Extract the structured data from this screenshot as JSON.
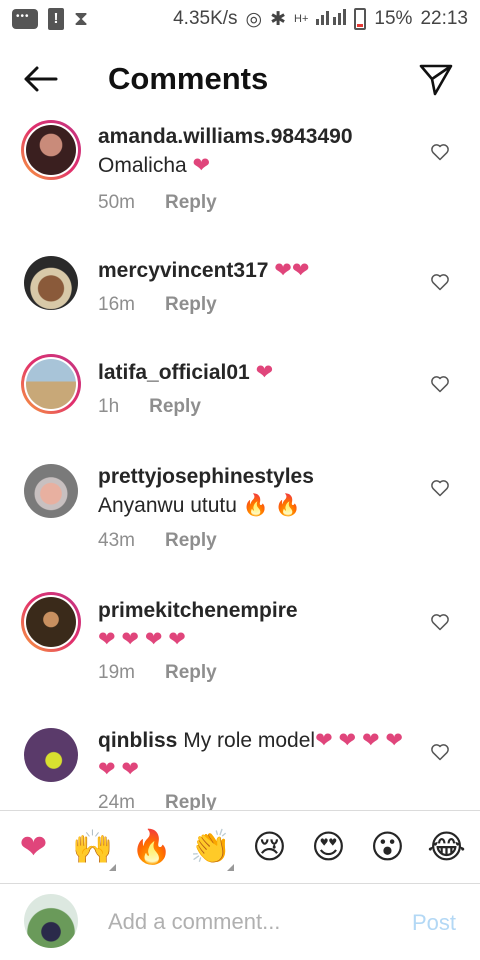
{
  "status_bar": {
    "speed": "4.35K/s",
    "network": "H+",
    "battery": "15%",
    "time": "22:13"
  },
  "header": {
    "title": "Comments",
    "back_icon": "arrow-left-icon",
    "send_icon": "paper-plane-icon"
  },
  "comments": [
    {
      "username": "amanda.williams.9843490",
      "text": "Omalicha",
      "emoji": "❤",
      "time": "50m",
      "reply": "Reply",
      "avatar_color": "#6b3a3a"
    },
    {
      "username": "mercyvincent317",
      "text": "",
      "emoji": "❤❤",
      "time": "16m",
      "reply": "Reply",
      "avatar_color": "#8a6a3a"
    },
    {
      "username": "latifa_official01",
      "text": "",
      "emoji": "❤",
      "time": "1h",
      "reply": "Reply",
      "avatar_color": "#6a8aa0"
    },
    {
      "username": "prettyjosephinestyles",
      "text": "Anyanwu ututu",
      "emoji": "🔥 🔥",
      "time": "43m",
      "reply": "Reply",
      "avatar_color": "#b0a0a0"
    },
    {
      "username": "primekitchenempire",
      "text": "",
      "emoji": "❤ ❤ ❤ ❤",
      "time": "19m",
      "reply": "Reply",
      "avatar_color": "#3a2a1a"
    },
    {
      "username": "qinbliss",
      "text": "My role model",
      "emoji": "❤ ❤ ❤ ❤ ❤ ❤",
      "time": "24m",
      "reply": "Reply",
      "avatar_color": "#4a3a5a"
    }
  ],
  "emoji_bar": [
    "❤",
    "🙌",
    "🔥",
    "👏",
    "😢",
    "😍",
    "😮",
    "😂"
  ],
  "composer": {
    "placeholder": "Add a comment...",
    "post_label": "Post"
  },
  "colors": {
    "heart": "#e0457b",
    "post_disabled": "#b3d8f5",
    "story_ring": "#e1306c"
  }
}
